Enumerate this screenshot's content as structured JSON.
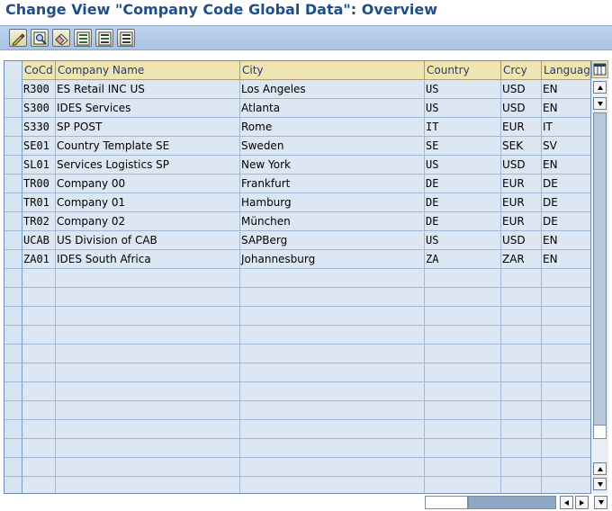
{
  "window": {
    "title": "Change View \"Company Code Global Data\": Overview"
  },
  "toolbar": {
    "buttons": [
      {
        "icon": "edit-icon"
      },
      {
        "icon": "display-icon"
      },
      {
        "icon": "delete-icon"
      },
      {
        "icon": "select-all-icon"
      },
      {
        "icon": "select-block-icon"
      },
      {
        "icon": "deselect-all-icon"
      }
    ]
  },
  "table": {
    "headers": {
      "cocd": "CoCd",
      "company_name": "Company Name",
      "city": "City",
      "country": "Country",
      "crcy": "Crcy",
      "language": "Language"
    },
    "rows": [
      {
        "cocd": "R300",
        "company_name": "ES Retail INC US",
        "city": "Los Angeles",
        "country": "US",
        "crcy": "USD",
        "language": "EN"
      },
      {
        "cocd": "S300",
        "company_name": "IDES Services",
        "city": "Atlanta",
        "country": "US",
        "crcy": "USD",
        "language": "EN"
      },
      {
        "cocd": "S330",
        "company_name": "SP POST",
        "city": "Rome",
        "country": "IT",
        "crcy": "EUR",
        "language": "IT"
      },
      {
        "cocd": "SE01",
        "company_name": "Country Template SE",
        "city": "Sweden",
        "country": "SE",
        "crcy": "SEK",
        "language": "SV"
      },
      {
        "cocd": "SL01",
        "company_name": "Services Logistics SP",
        "city": "New York",
        "country": "US",
        "crcy": "USD",
        "language": "EN"
      },
      {
        "cocd": "TR00",
        "company_name": "Company 00",
        "city": "Frankfurt",
        "country": "DE",
        "crcy": "EUR",
        "language": "DE"
      },
      {
        "cocd": "TR01",
        "company_name": "Company 01",
        "city": "Hamburg",
        "country": "DE",
        "crcy": "EUR",
        "language": "DE"
      },
      {
        "cocd": "TR02",
        "company_name": "Company 02",
        "city": "München",
        "country": "DE",
        "crcy": "EUR",
        "language": "DE"
      },
      {
        "cocd": "UCAB",
        "company_name": "US Division of CAB",
        "city": "SAPBerg",
        "country": "US",
        "crcy": "USD",
        "language": "EN"
      },
      {
        "cocd": "ZA01",
        "company_name": "IDES South Africa",
        "city": "Johannesburg",
        "country": "ZA",
        "crcy": "ZAR",
        "language": "EN"
      }
    ],
    "empty_row_count": 12
  },
  "colors": {
    "title": "#1f4f8a",
    "header_bg": "#f0e4b2",
    "cell_bg": "#dde7f3",
    "toolbar_bg": "#a9c3e4"
  }
}
